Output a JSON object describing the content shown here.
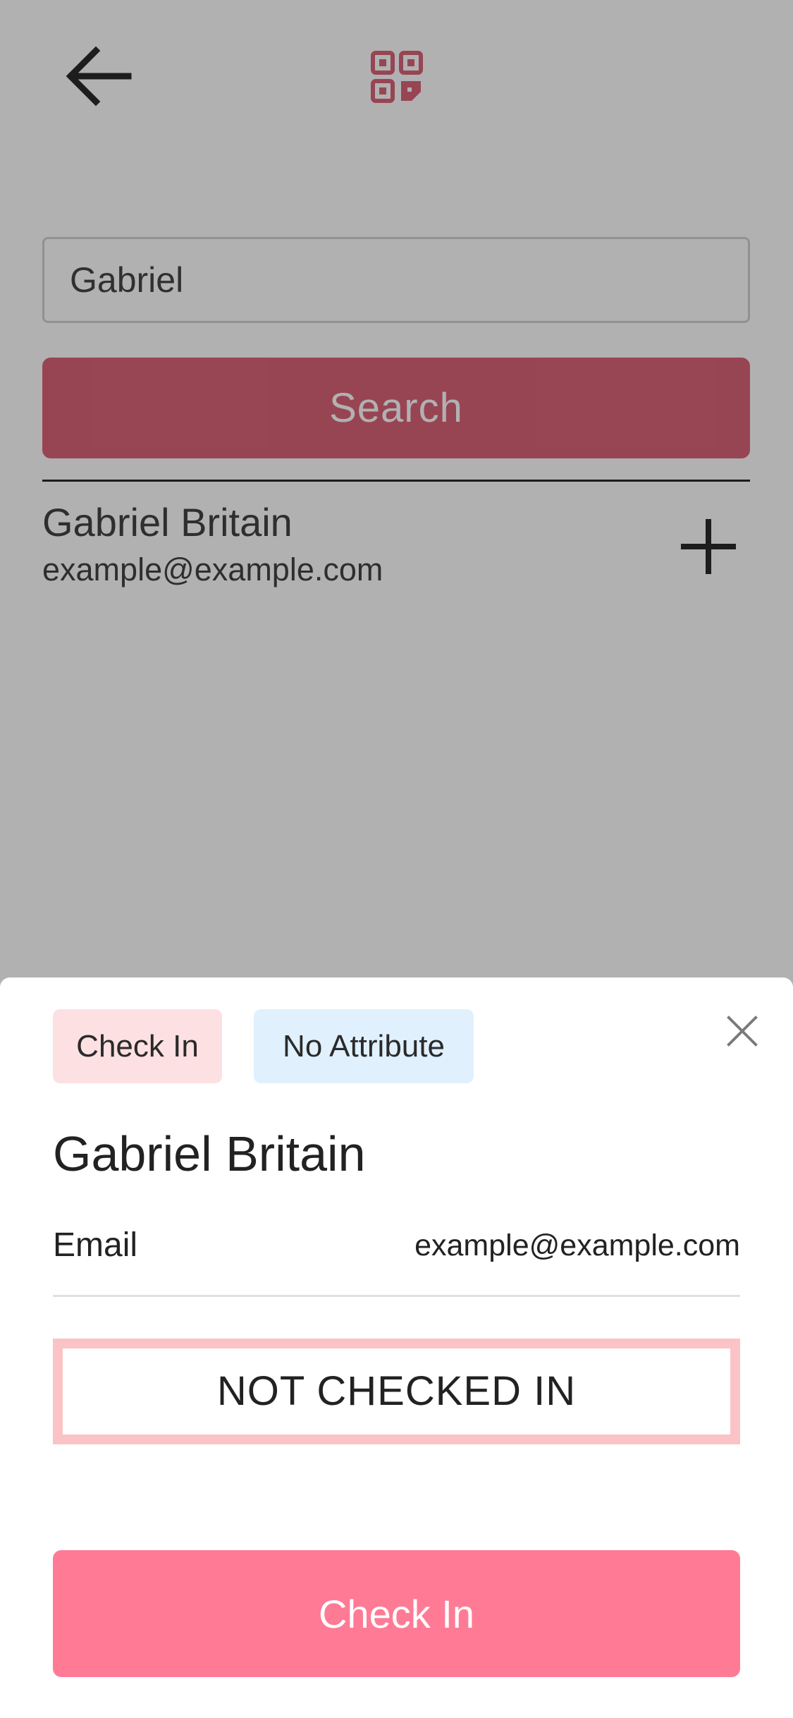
{
  "colors": {
    "accent": "#d5465c",
    "check_in_button": "#ff7b95",
    "chip_checkin_bg": "#fde0e2",
    "chip_attribute_bg": "#e0f0fd",
    "status_border": "#fbc3c5"
  },
  "header": {
    "back_icon": "arrow-left-icon",
    "qr_icon": "qr-code-icon"
  },
  "search": {
    "value": "Gabriel",
    "button_label": "Search"
  },
  "results": [
    {
      "name": "Gabriel Britain",
      "email": "example@example.com",
      "action_icon": "plus-icon"
    }
  ],
  "sheet": {
    "chips": [
      "Check In",
      "No Attribute"
    ],
    "close_icon": "close-icon",
    "name": "Gabriel Britain",
    "email_label": "Email",
    "email_value": "example@example.com",
    "status": "NOT CHECKED IN",
    "check_in_label": "Check In"
  }
}
